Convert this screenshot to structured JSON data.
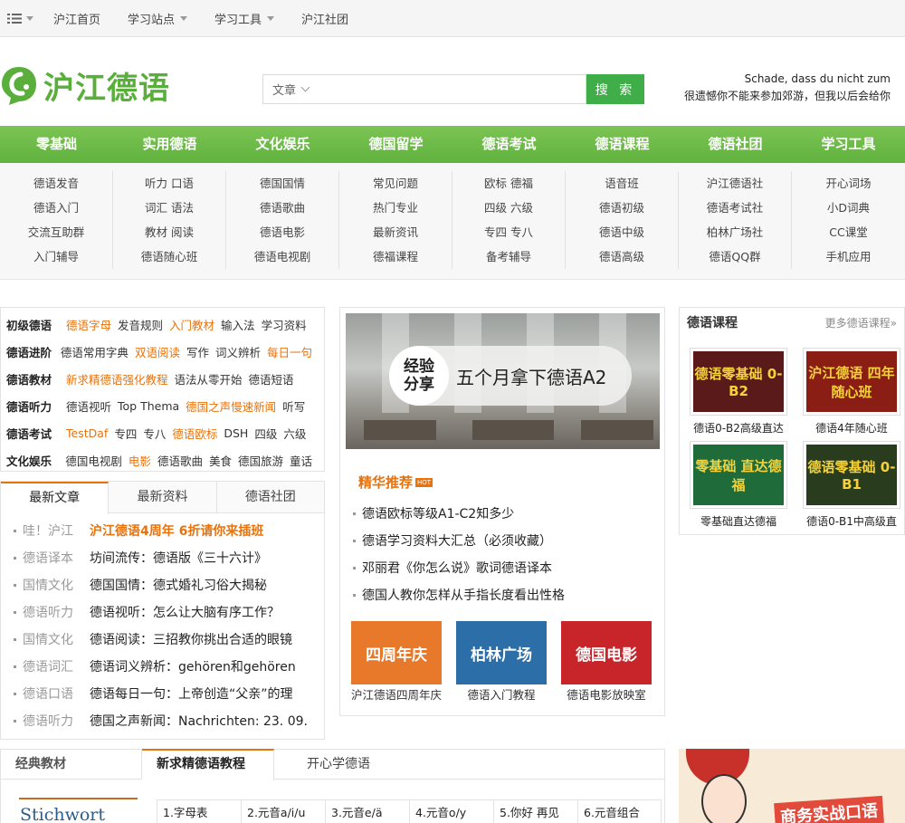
{
  "topbar": {
    "items": [
      {
        "label": "沪江首页",
        "dropdown": false
      },
      {
        "label": "学习站点",
        "dropdown": true
      },
      {
        "label": "学习工具",
        "dropdown": true
      },
      {
        "label": "沪江社团",
        "dropdown": false
      }
    ]
  },
  "header": {
    "logo_text": "沪江德语",
    "search_scope": "文章",
    "search_placeholder": "",
    "search_button": "搜 索",
    "slogan_de": "Schade, dass du nicht zum",
    "slogan_cn": "很遗憾你不能来参加郊游，但我以后会给你"
  },
  "nav": {
    "categories": [
      "零基础",
      "实用德语",
      "文化娱乐",
      "德国留学",
      "德语考试",
      "德语课程",
      "德语社团",
      "学习工具"
    ],
    "columns": [
      [
        "德语发音",
        "德语入门",
        "交流互助群",
        "入门辅导"
      ],
      [
        "听力 口语",
        "词汇 语法",
        "教材 阅读",
        "德语随心班"
      ],
      [
        "德国国情",
        "德语歌曲",
        "德语电影",
        "德语电视剧"
      ],
      [
        "常见问题",
        "热门专业",
        "最新资讯",
        "德福课程"
      ],
      [
        "欧标 德福",
        "四级 六级",
        "专四 专八",
        "备考辅导"
      ],
      [
        "语音班",
        "德语初级",
        "德语中级",
        "德语高级"
      ],
      [
        "沪江德语社",
        "德语考试社",
        "柏林广场社",
        "德语QQ群"
      ],
      [
        "开心词场",
        "小D词典",
        "CC课堂",
        "手机应用"
      ]
    ]
  },
  "categories": [
    {
      "head": "初级德语",
      "links": [
        {
          "t": "德语字母",
          "hl": true
        },
        {
          "t": "发音规则",
          "hl": false
        },
        {
          "t": "入门教材",
          "hl": true
        },
        {
          "t": "输入法",
          "hl": false
        },
        {
          "t": "学习资料",
          "hl": false
        }
      ]
    },
    {
      "head": "德语进阶",
      "links": [
        {
          "t": "德语常用字典",
          "hl": false
        },
        {
          "t": "双语阅读",
          "hl": true
        },
        {
          "t": "写作",
          "hl": false
        },
        {
          "t": "词义辨析",
          "hl": false
        },
        {
          "t": "每日一句",
          "hl": true
        }
      ]
    },
    {
      "head": "德语教材",
      "links": [
        {
          "t": "新求精德语强化教程",
          "hl": true
        },
        {
          "t": "语法从零开始",
          "hl": false
        },
        {
          "t": "德语短语",
          "hl": false
        }
      ]
    },
    {
      "head": "德语听力",
      "links": [
        {
          "t": "德语视听",
          "hl": false
        },
        {
          "t": "Top Thema",
          "hl": false
        },
        {
          "t": "德国之声慢速新闻",
          "hl": true
        },
        {
          "t": "听写",
          "hl": false
        }
      ]
    },
    {
      "head": "德语考试",
      "links": [
        {
          "t": "TestDaf",
          "hl": true
        },
        {
          "t": "专四",
          "hl": false
        },
        {
          "t": "专八",
          "hl": false
        },
        {
          "t": "德语欧标",
          "hl": true
        },
        {
          "t": "DSH",
          "hl": false
        },
        {
          "t": "四级",
          "hl": false
        },
        {
          "t": "六级",
          "hl": false
        }
      ]
    },
    {
      "head": "文化娱乐",
      "links": [
        {
          "t": "德国电视剧",
          "hl": false
        },
        {
          "t": "电影",
          "hl": true
        },
        {
          "t": "德语歌曲",
          "hl": false
        },
        {
          "t": "美食",
          "hl": false
        },
        {
          "t": "德国旅游",
          "hl": false
        },
        {
          "t": "童话",
          "hl": false
        }
      ]
    }
  ],
  "news": {
    "tabs": [
      "最新文章",
      "最新资料",
      "德语社团"
    ],
    "items": [
      {
        "tag": "哇！沪江",
        "title": "沪江德语4周年 6折请你来插班",
        "highlight": true
      },
      {
        "tag": "德语译本",
        "title": "坊间流传：德语版《三十六计》",
        "highlight": false
      },
      {
        "tag": "国情文化",
        "title": "德国国情：德式婚礼习俗大揭秘",
        "highlight": false
      },
      {
        "tag": "德语听力",
        "title": "德语视听：怎么让大脑有序工作？",
        "highlight": false
      },
      {
        "tag": "国情文化",
        "title": "德语阅读：三招教你挑出合适的眼镜",
        "highlight": false
      },
      {
        "tag": "德语词汇",
        "title": "德语词义辨析：gehören和gehören",
        "highlight": false
      },
      {
        "tag": "德语口语",
        "title": "德语每日一句：上帝创造“父亲”的理",
        "highlight": false
      },
      {
        "tag": "德语听力",
        "title": "德国之声新闻：Nachrichten: 23. 09.",
        "highlight": false
      }
    ]
  },
  "featured": {
    "banner_badge": "经验分享",
    "banner_title": "五个月拿下德语A2",
    "section_title": "精华推荐",
    "hot_label": "HOT",
    "items": [
      "德语欧标等级A1-C2知多少",
      "德语学习资料大汇总（必须收藏）",
      "邓丽君《你怎么说》歌词德语译本",
      "德国人教你怎样从手指长度看出性格"
    ],
    "thumbs": [
      {
        "img_text": "四周年庆",
        "caption": "沪江德语四周年庆",
        "color": "#e8792a"
      },
      {
        "img_text": "柏林广场",
        "caption": "德语入门教程",
        "color": "#2b6ea8"
      },
      {
        "img_text": "德国电影",
        "caption": "德语电影放映室",
        "color": "#c8252b"
      }
    ]
  },
  "courses": {
    "title": "德语课程",
    "more": "更多德语课程»",
    "items": [
      {
        "img_text": "德语零基础 0-B2",
        "caption": "德语0-B2高级直达",
        "color": "#5a1a1a"
      },
      {
        "img_text": "沪江德语 四年 随心班",
        "caption": "德语4年随心班",
        "color": "#8a1e14"
      },
      {
        "img_text": "零基础 直达德福",
        "caption": "零基础直达德福",
        "color": "#1f6b3a"
      },
      {
        "img_text": "德语零基础 0-B1",
        "caption": "德语0-B1中高级直",
        "color": "#2a3c1e"
      }
    ]
  },
  "bottom": {
    "tabs": [
      "经典教材",
      "新求精德语教程",
      "开心学德语"
    ],
    "book_text": "Stichwort",
    "lessons": [
      "1.字母表",
      "2.元音a/i/u",
      "3.元音e/ä",
      "4.元音o/y",
      "5.你好 再见",
      "6.元音组合"
    ],
    "promo_text": "商务实战口语"
  },
  "colors": {
    "brand_green": "#5aae3b",
    "accent_orange": "#e8720c",
    "nav_green": "#6bb845"
  }
}
